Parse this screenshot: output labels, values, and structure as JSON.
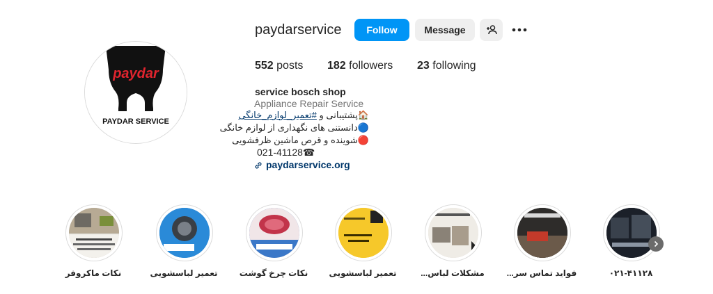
{
  "profile": {
    "username": "paydarservice",
    "logo_wordmark": "paydar",
    "logo_caption": "PAYDAR SERVICE"
  },
  "actions": {
    "follow_label": "Follow",
    "message_label": "Message",
    "suggest_icon": "add-person-icon",
    "more_icon": "more-options-icon"
  },
  "stats": [
    {
      "count": "552",
      "label": "posts"
    },
    {
      "count": "182",
      "label": "followers"
    },
    {
      "count": "23",
      "label": "following"
    }
  ],
  "bio": {
    "name": "service bosch shop",
    "category": "Appliance Repair Service",
    "line1_prefix": "پشتیبانی و ",
    "line1_hashtag": "#تعمیر_لوازم_خانگی",
    "line1_icon": "🏠",
    "line2_text": "دانستنی های نگهداری از لوازم خانگی",
    "line2_icon": "🔵",
    "line3_text": "شوینده و قرص ماشین ظرفشویی",
    "line3_icon": "🔴",
    "phone": "021-41128☎",
    "link_icon": "link-icon",
    "link": "paydarservice.org"
  },
  "highlights": [
    {
      "label": "نکات ماکروفر",
      "color": "#c9c2b4"
    },
    {
      "label": "تعمیر لباسشویی",
      "color": "#2a8ad8"
    },
    {
      "label": "نکات چرخ گوشت",
      "color": "#e7d3d8"
    },
    {
      "label": "تعمیر لباسشویی",
      "color": "#f6c82a"
    },
    {
      "label": "مشکلات لباس...",
      "color": "#d9d5cf"
    },
    {
      "label": "فواید تماس سر...",
      "color": "#3a3a3a"
    },
    {
      "label": "۰۲۱-۴۱۱۲۸",
      "color": "#1f2630"
    }
  ],
  "highlight_next_icon": "chevron-right-icon"
}
